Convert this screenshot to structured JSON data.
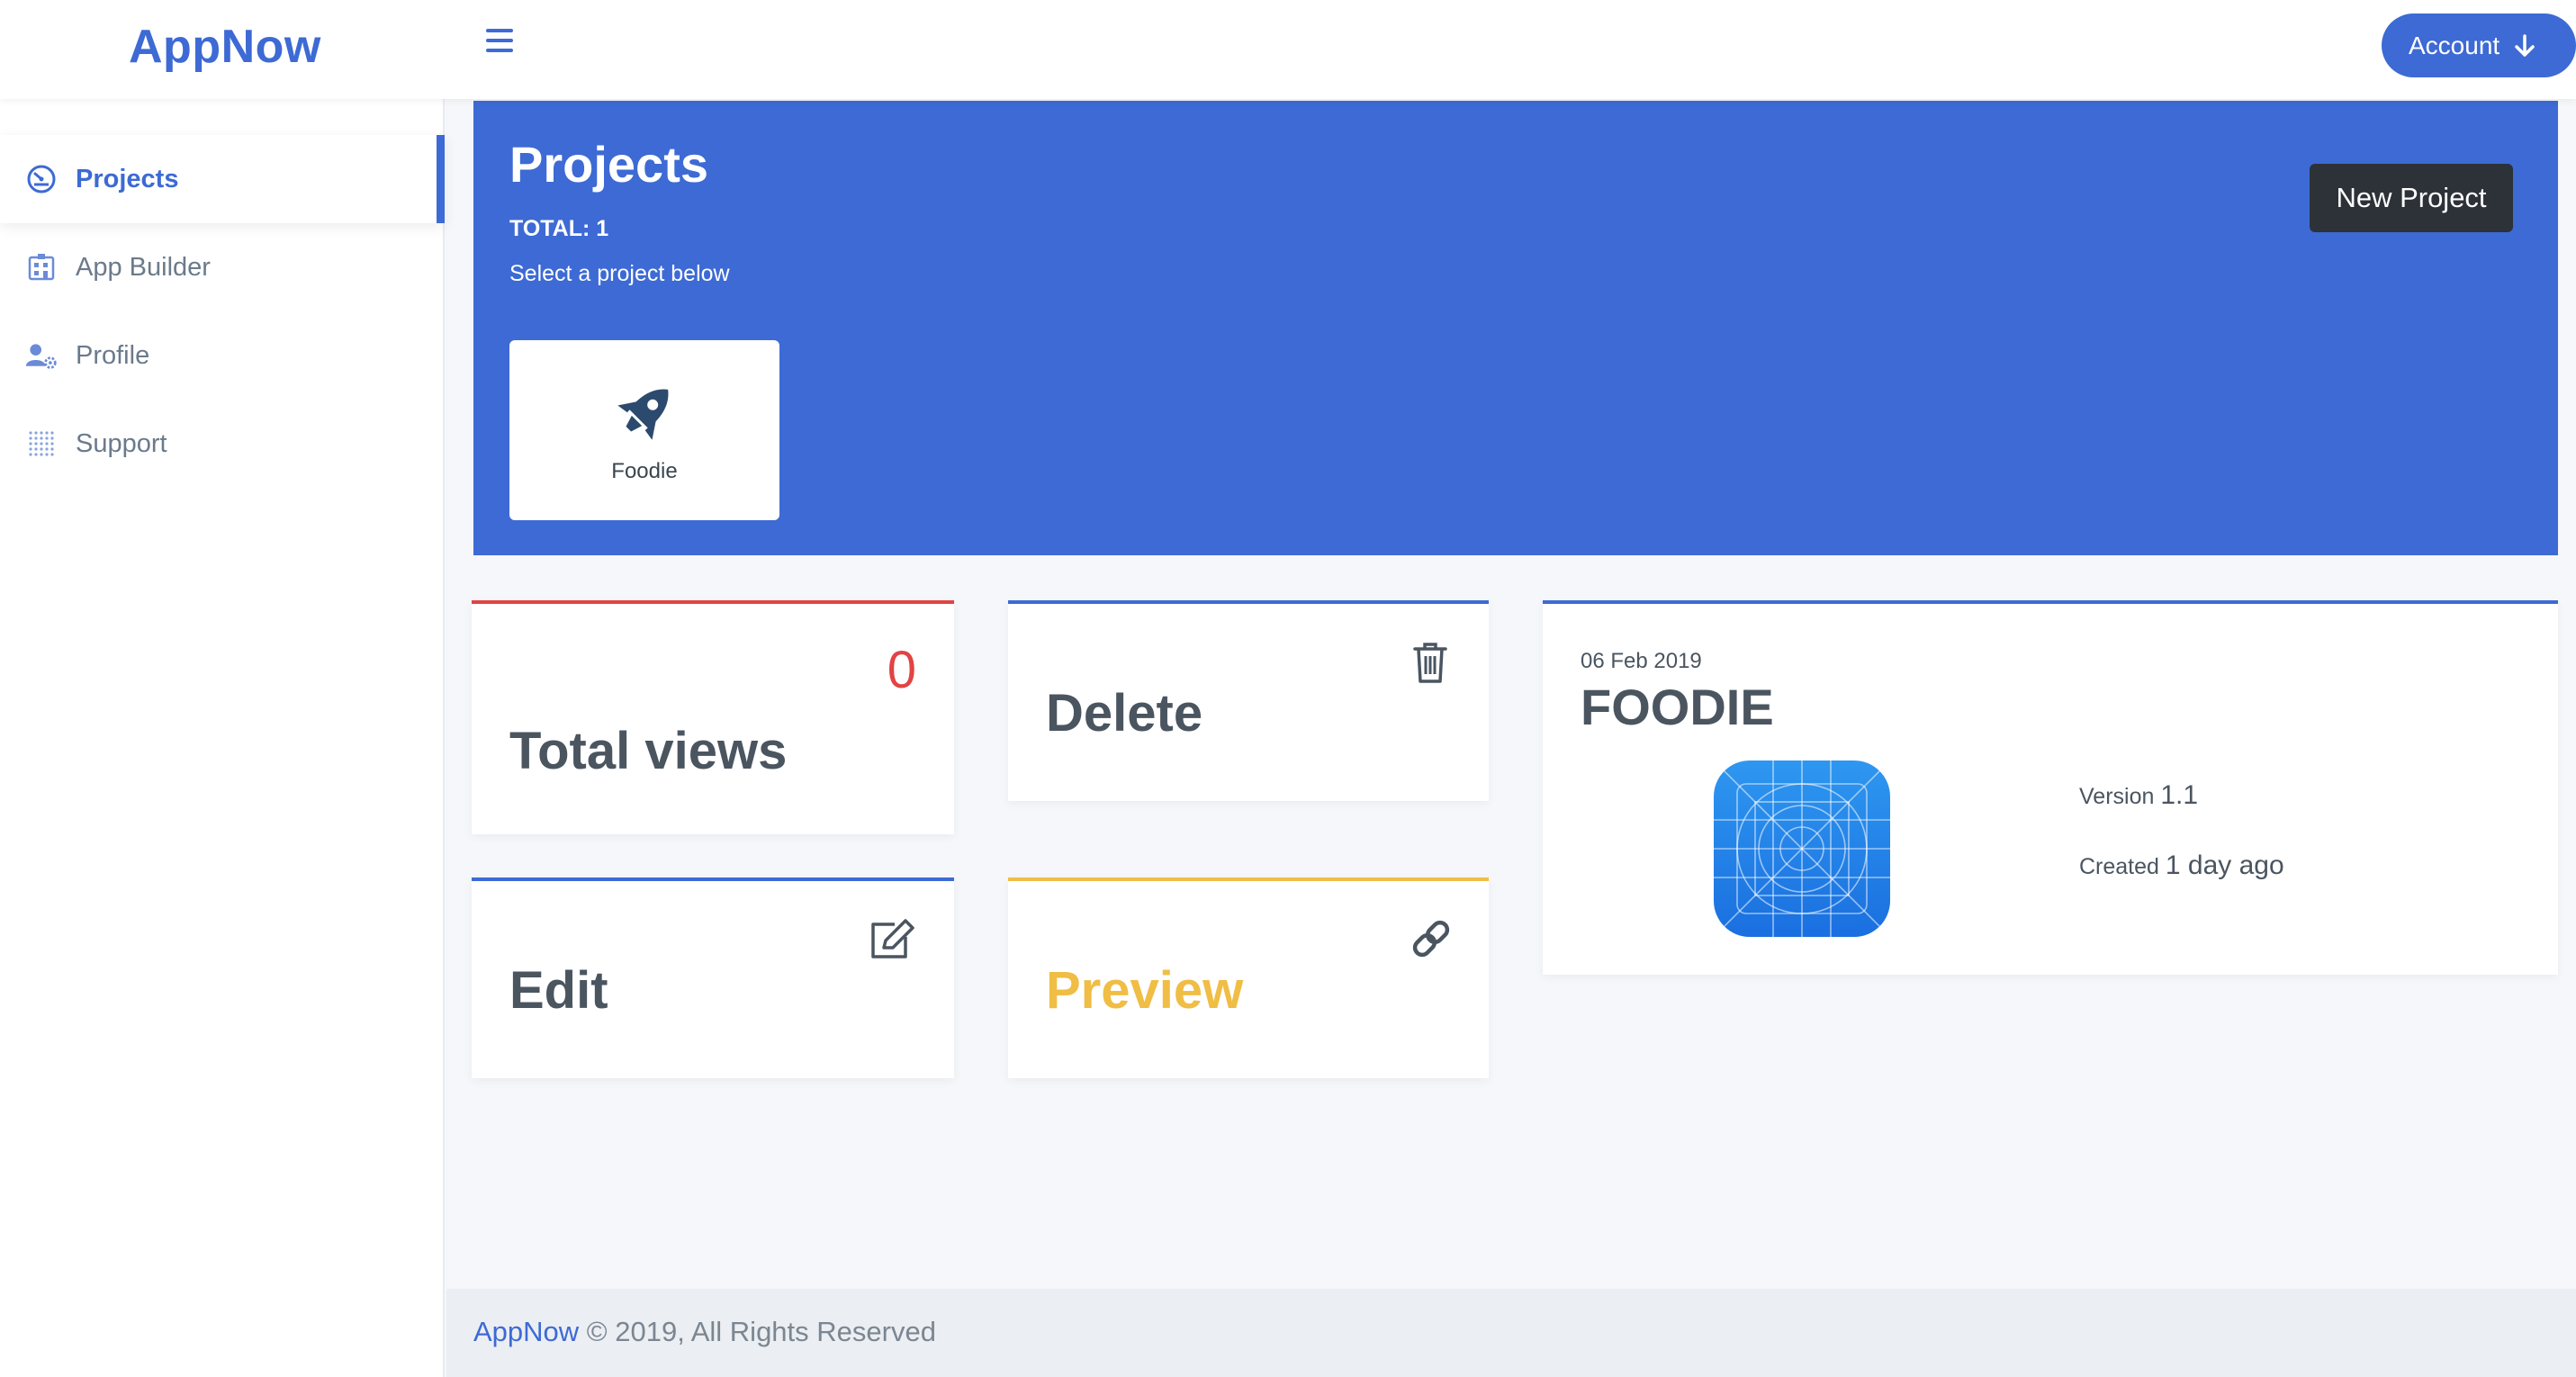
{
  "app": {
    "brand": "AppNow"
  },
  "header": {
    "account_label": "Account"
  },
  "sidebar": {
    "items": [
      {
        "label": "Projects",
        "icon": "dashboard-gauge-icon",
        "active": true
      },
      {
        "label": "App Builder",
        "icon": "building-icon",
        "active": false
      },
      {
        "label": "Profile",
        "icon": "user-cog-icon",
        "active": false
      },
      {
        "label": "Support",
        "icon": "dot-grid-icon",
        "active": false
      }
    ]
  },
  "banner": {
    "title": "Projects",
    "total": "TOTAL: 1",
    "subtitle": "Select a project below",
    "new_project_label": "New Project",
    "projects": [
      {
        "name": "Foodie",
        "icon": "rocket-icon"
      }
    ]
  },
  "cards": {
    "views": {
      "label": "Total views",
      "count": "0"
    },
    "delete": {
      "label": "Delete",
      "icon": "trash-icon"
    },
    "edit": {
      "label": "Edit",
      "icon": "edit-icon"
    },
    "preview": {
      "label": "Preview",
      "icon": "link-icon"
    }
  },
  "project_info": {
    "date": "06 Feb 2019",
    "name": "FOODIE",
    "version_label": "Version",
    "version": "1.1",
    "created_label": "Created",
    "created": "1 day ago"
  },
  "footer": {
    "brand": "AppNow",
    "text": "© 2019, All Rights Reserved"
  },
  "colors": {
    "primary": "#3d6ad4",
    "dark_button": "#2c3238",
    "views_accent": "#e24343",
    "preview_accent": "#f0bd45",
    "text": "#4a5560"
  }
}
